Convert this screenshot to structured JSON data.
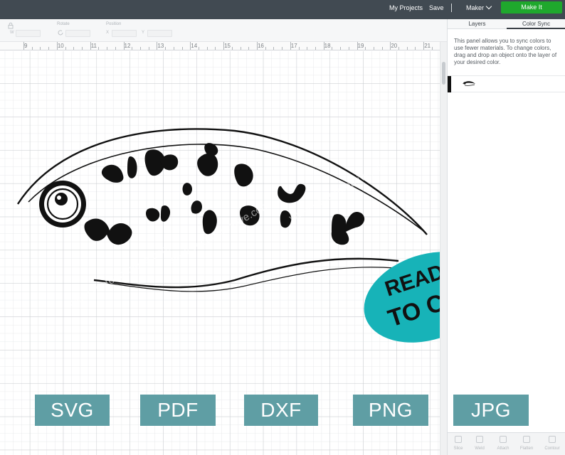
{
  "topbar": {
    "my_projects": "My Projects",
    "save": "Save",
    "separator": "|",
    "machine": "Maker",
    "make_it": "Make It"
  },
  "toolbar": {
    "rotate_label": "Rotate",
    "position_label": "Position",
    "w_label": "W",
    "x_label": "X",
    "y_label": "Y"
  },
  "ruler": {
    "numbers": [
      "9",
      "10",
      "11",
      "12",
      "13",
      "14",
      "15",
      "16",
      "17",
      "18",
      "19",
      "20",
      "21"
    ]
  },
  "panel": {
    "tabs": [
      "Layers",
      "Color Sync"
    ],
    "active_tab": "Color Sync",
    "description": "This panel allows you to sync colors to use fewer materials. To change colors, drag and drop an object onto the layer of your desired color.",
    "swatch_color": "#111111",
    "bottom_actions": [
      "Slice",
      "Weld",
      "Attach",
      "Flatten",
      "Contour"
    ]
  },
  "artwork": {
    "badge_line1": "READY",
    "badge_line2": "TO CUT",
    "badge_color": "#17b3b8",
    "watermark": "www.vectorcreative.com"
  },
  "formats": [
    "SVG",
    "PDF",
    "DXF",
    "PNG",
    "JPG"
  ],
  "colors": {
    "topbar": "#414a52",
    "make_it": "#1fa82d",
    "format_badge": "#5f9ea4"
  }
}
